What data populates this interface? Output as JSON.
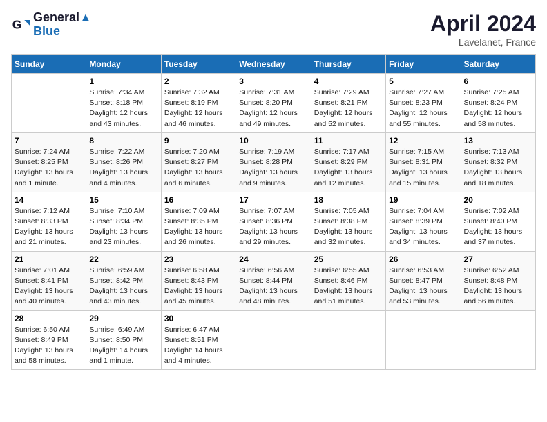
{
  "header": {
    "logo_line1": "General",
    "logo_line2": "Blue",
    "month": "April 2024",
    "location": "Lavelanet, France"
  },
  "days_of_week": [
    "Sunday",
    "Monday",
    "Tuesday",
    "Wednesday",
    "Thursday",
    "Friday",
    "Saturday"
  ],
  "weeks": [
    [
      {
        "day": "",
        "info": ""
      },
      {
        "day": "1",
        "info": "Sunrise: 7:34 AM\nSunset: 8:18 PM\nDaylight: 12 hours\nand 43 minutes."
      },
      {
        "day": "2",
        "info": "Sunrise: 7:32 AM\nSunset: 8:19 PM\nDaylight: 12 hours\nand 46 minutes."
      },
      {
        "day": "3",
        "info": "Sunrise: 7:31 AM\nSunset: 8:20 PM\nDaylight: 12 hours\nand 49 minutes."
      },
      {
        "day": "4",
        "info": "Sunrise: 7:29 AM\nSunset: 8:21 PM\nDaylight: 12 hours\nand 52 minutes."
      },
      {
        "day": "5",
        "info": "Sunrise: 7:27 AM\nSunset: 8:23 PM\nDaylight: 12 hours\nand 55 minutes."
      },
      {
        "day": "6",
        "info": "Sunrise: 7:25 AM\nSunset: 8:24 PM\nDaylight: 12 hours\nand 58 minutes."
      }
    ],
    [
      {
        "day": "7",
        "info": "Sunrise: 7:24 AM\nSunset: 8:25 PM\nDaylight: 13 hours\nand 1 minute."
      },
      {
        "day": "8",
        "info": "Sunrise: 7:22 AM\nSunset: 8:26 PM\nDaylight: 13 hours\nand 4 minutes."
      },
      {
        "day": "9",
        "info": "Sunrise: 7:20 AM\nSunset: 8:27 PM\nDaylight: 13 hours\nand 6 minutes."
      },
      {
        "day": "10",
        "info": "Sunrise: 7:19 AM\nSunset: 8:28 PM\nDaylight: 13 hours\nand 9 minutes."
      },
      {
        "day": "11",
        "info": "Sunrise: 7:17 AM\nSunset: 8:29 PM\nDaylight: 13 hours\nand 12 minutes."
      },
      {
        "day": "12",
        "info": "Sunrise: 7:15 AM\nSunset: 8:31 PM\nDaylight: 13 hours\nand 15 minutes."
      },
      {
        "day": "13",
        "info": "Sunrise: 7:13 AM\nSunset: 8:32 PM\nDaylight: 13 hours\nand 18 minutes."
      }
    ],
    [
      {
        "day": "14",
        "info": "Sunrise: 7:12 AM\nSunset: 8:33 PM\nDaylight: 13 hours\nand 21 minutes."
      },
      {
        "day": "15",
        "info": "Sunrise: 7:10 AM\nSunset: 8:34 PM\nDaylight: 13 hours\nand 23 minutes."
      },
      {
        "day": "16",
        "info": "Sunrise: 7:09 AM\nSunset: 8:35 PM\nDaylight: 13 hours\nand 26 minutes."
      },
      {
        "day": "17",
        "info": "Sunrise: 7:07 AM\nSunset: 8:36 PM\nDaylight: 13 hours\nand 29 minutes."
      },
      {
        "day": "18",
        "info": "Sunrise: 7:05 AM\nSunset: 8:38 PM\nDaylight: 13 hours\nand 32 minutes."
      },
      {
        "day": "19",
        "info": "Sunrise: 7:04 AM\nSunset: 8:39 PM\nDaylight: 13 hours\nand 34 minutes."
      },
      {
        "day": "20",
        "info": "Sunrise: 7:02 AM\nSunset: 8:40 PM\nDaylight: 13 hours\nand 37 minutes."
      }
    ],
    [
      {
        "day": "21",
        "info": "Sunrise: 7:01 AM\nSunset: 8:41 PM\nDaylight: 13 hours\nand 40 minutes."
      },
      {
        "day": "22",
        "info": "Sunrise: 6:59 AM\nSunset: 8:42 PM\nDaylight: 13 hours\nand 43 minutes."
      },
      {
        "day": "23",
        "info": "Sunrise: 6:58 AM\nSunset: 8:43 PM\nDaylight: 13 hours\nand 45 minutes."
      },
      {
        "day": "24",
        "info": "Sunrise: 6:56 AM\nSunset: 8:44 PM\nDaylight: 13 hours\nand 48 minutes."
      },
      {
        "day": "25",
        "info": "Sunrise: 6:55 AM\nSunset: 8:46 PM\nDaylight: 13 hours\nand 51 minutes."
      },
      {
        "day": "26",
        "info": "Sunrise: 6:53 AM\nSunset: 8:47 PM\nDaylight: 13 hours\nand 53 minutes."
      },
      {
        "day": "27",
        "info": "Sunrise: 6:52 AM\nSunset: 8:48 PM\nDaylight: 13 hours\nand 56 minutes."
      }
    ],
    [
      {
        "day": "28",
        "info": "Sunrise: 6:50 AM\nSunset: 8:49 PM\nDaylight: 13 hours\nand 58 minutes."
      },
      {
        "day": "29",
        "info": "Sunrise: 6:49 AM\nSunset: 8:50 PM\nDaylight: 14 hours\nand 1 minute."
      },
      {
        "day": "30",
        "info": "Sunrise: 6:47 AM\nSunset: 8:51 PM\nDaylight: 14 hours\nand 4 minutes."
      },
      {
        "day": "",
        "info": ""
      },
      {
        "day": "",
        "info": ""
      },
      {
        "day": "",
        "info": ""
      },
      {
        "day": "",
        "info": ""
      }
    ]
  ]
}
